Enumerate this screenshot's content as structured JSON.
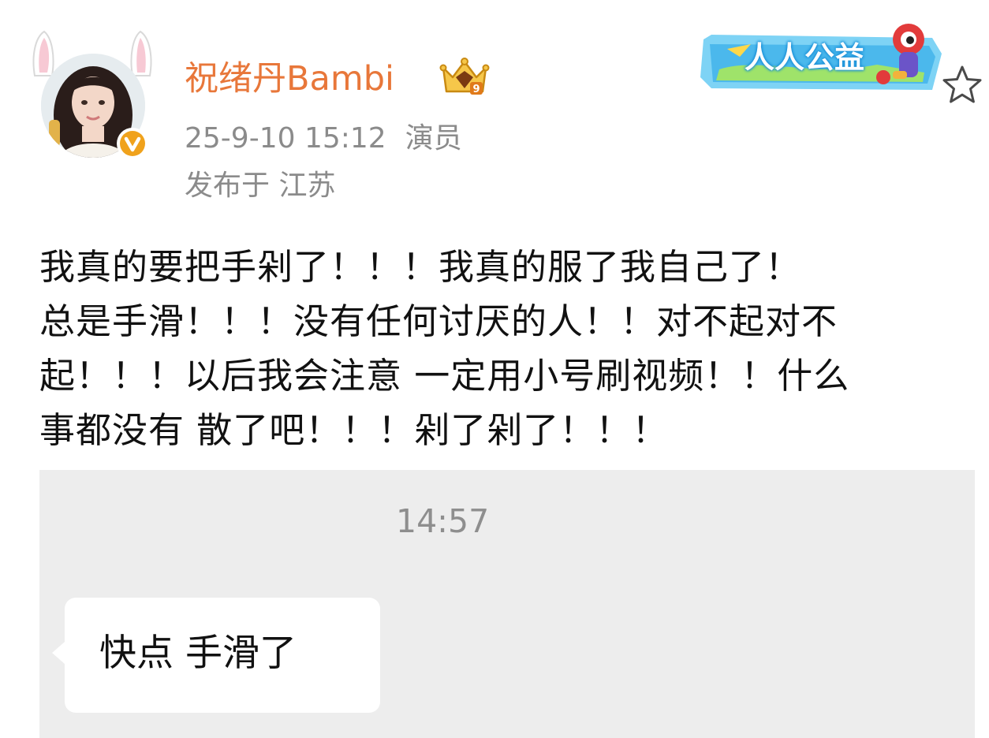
{
  "header": {
    "username": "祝绪丹Bambi",
    "timestamp": "25-9-10 15:12",
    "role": "演员",
    "location": "发布于 江苏",
    "charity_label": "人人公益",
    "crown_level": "9"
  },
  "post": {
    "lines": [
      "我真的要把手剁了！！！我真的服了我自己了！",
      "总是手滑！！！没有任何讨厌的人！！对不起对不",
      "起！！！以后我会注意 一定用小号刷视频！！什么",
      "事都没有 散了吧！！！剁了剁了！！！"
    ]
  },
  "chat": {
    "time": "14:57",
    "message": "快点 手滑了"
  },
  "colors": {
    "username": "#e8773a",
    "meta": "#8b8b8b",
    "chat_bg": "#ededed",
    "verified_badge": "#f0a21c"
  },
  "icons": [
    "bunny-ears-icon",
    "verified-badge-icon",
    "crown-badge-icon",
    "charity-banner",
    "star-icon"
  ]
}
